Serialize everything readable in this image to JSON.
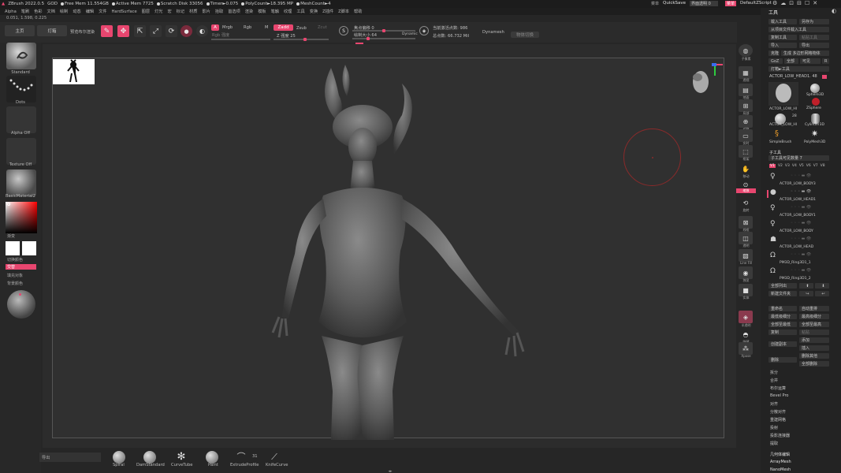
{
  "titlebar": {
    "app": "ZBrush 2022.0.5",
    "user": "GOD",
    "free_mem": "Free Mem 11.554GB",
    "active_mem": "Active Mem 7725",
    "scratch": "Scratch Disk 33056",
    "timer": "Timer►0.075",
    "polycount": "PolyCount►18.395 MP",
    "meshcount": "MeshCount►4",
    "menu_label": "菜单",
    "quicksave": "QuickSave",
    "transparency": "界面透明 0",
    "menus_btn": "菜单",
    "script": "DefaultZScript"
  },
  "menubar": {
    "items": [
      "Alpha",
      "笔刷",
      "色彩",
      "文档",
      "绘制",
      "动态",
      "编辑",
      "文件",
      "HardSurface",
      "图层",
      "灯光",
      "宏",
      "标记",
      "材质",
      "影片",
      "拾取",
      "首选项",
      "渲染",
      "模板",
      "笔触",
      "纹理",
      "工具",
      "变换",
      "Z插件",
      "Z脚本",
      "帮助"
    ]
  },
  "coords": "0.051, 1.598, 0.225",
  "toolbar": {
    "home": "主页",
    "lightbox": "灯箱",
    "preview_render": "预览布尔渲染",
    "edit": "Edit",
    "draw": "Draw",
    "move": "Move",
    "scale": "Scale",
    "rotate": "Rotate",
    "a_label": "A",
    "mrgb": "Mrgb",
    "rgb": "Rgb",
    "m": "M",
    "zadd": "Zadd",
    "zsub": "Zsub",
    "zcut": "Zcut",
    "rgb_strength": "Rgb 强度",
    "z_strength": "Z 强度 25",
    "focal_shift": "焦点偏移 0",
    "draw_size": "绘制大小 64",
    "dynamic": "Dynamic",
    "active_points": "当前激活点数: 986",
    "total_points": "总点数: 66.732 Mil",
    "dynamesh": "Dynamesh",
    "tool_shortcut": "物体切换"
  },
  "leftpanel": {
    "standard": "Standard",
    "dots": "Dots",
    "alpha_off": "Alpha Off",
    "texture_off": "Texture Off",
    "material": "BasicMaterial2",
    "gradient": "渐变",
    "switch_color": "切换颜色",
    "alternate": "交替",
    "fill_object": "填充对象",
    "back_color": "背景颜色"
  },
  "rightstrip": {
    "labels": [
      "子像素",
      "透视",
      "地面",
      "局部",
      "对称",
      "实时",
      "框架",
      "移动",
      "缩放",
      "旋转",
      "线框",
      "透明",
      "Line Fill",
      "独显",
      "实体",
      "半透明",
      "隐藏",
      "Xpose"
    ]
  },
  "rightpanel": {
    "title": "工具",
    "load_tool": "载入工具",
    "save_as": "另存为",
    "load_from_project": "从项目文件载入工具",
    "copy_tool": "复制工具",
    "paste_tool": "粘贴工具",
    "import": "导入",
    "export": "导出",
    "clone": "克隆",
    "make_polymesh": "生成 多边形网格物体",
    "goz": "GoZ",
    "all": "全部",
    "visible": "可见",
    "goz_count": "R",
    "lightbox_tool": "灯箱►工具",
    "current_tool": "ACTOR_LOW_HEAD1. 48",
    "tools": [
      {
        "name": "ACTOR_LOW_HI",
        "count": ""
      },
      {
        "name": "Sphere3D",
        "count": ""
      },
      {
        "name": "ACTOR_LOW_HI",
        "count": "28"
      },
      {
        "name": "ZSphere",
        "count": ""
      },
      {
        "name": "SimpleBrush",
        "count": ""
      },
      {
        "name": "Cylinder3D",
        "count": ""
      },
      {
        "name": "PolyMesh3D",
        "count": ""
      }
    ],
    "subtool_title": "子工具",
    "subtool_count": "子工具可见数量 7",
    "versions": [
      "V1",
      "V2",
      "V3",
      "V4",
      "V5",
      "V6",
      "V7",
      "V8"
    ],
    "subtools": [
      "ACTOR_LOW_BODY3",
      "ACTOR_LOW_HEAD1",
      "ACTOR_LOW_BODY1",
      "ACTOR_LOW_BODY",
      "ACTOR_LOW_HEAD",
      "PM3D_Ring3D1_1",
      "PM3D_Ring3D1_2"
    ],
    "list_all": "全部列出",
    "new_folder": "新建文件夹",
    "rename": "重命名",
    "auto_reorder": "自动重排",
    "lowest_subdiv": "最低级细分",
    "highest_subdiv": "最高级细分",
    "all_lowest": "全部至最低",
    "all_highest": "全部至最高",
    "duplicate": "复制",
    "paste": "粘贴",
    "add": "添加",
    "insert": "插入",
    "create_copy": "创建副本",
    "delete": "删除",
    "delete_others": "删除其他",
    "delete_all": "全部删除",
    "split": "拆分",
    "merge": "合并",
    "boolean": "布尔运算",
    "bevel_pro": "Bevel Pro",
    "align": "对齐",
    "distribute": "分散对齐",
    "remesh": "重建网格",
    "project": "投射",
    "project_brush": "投影连接器",
    "extract": "提取",
    "geometry_edit": "几何体编辑",
    "arraymesh": "ArrayMesh",
    "nanomesh": "NanoMesh"
  },
  "bottombar": {
    "input_label": "导出",
    "brushes": [
      "Spiral",
      "DamStandard",
      "CurveTube",
      "Paint",
      "ExtrudeProfile",
      "KnifeCurve"
    ],
    "extrude_count": "31"
  },
  "colors": {
    "accent": "#e8466f",
    "background": "#262626",
    "panel": "#282828"
  }
}
